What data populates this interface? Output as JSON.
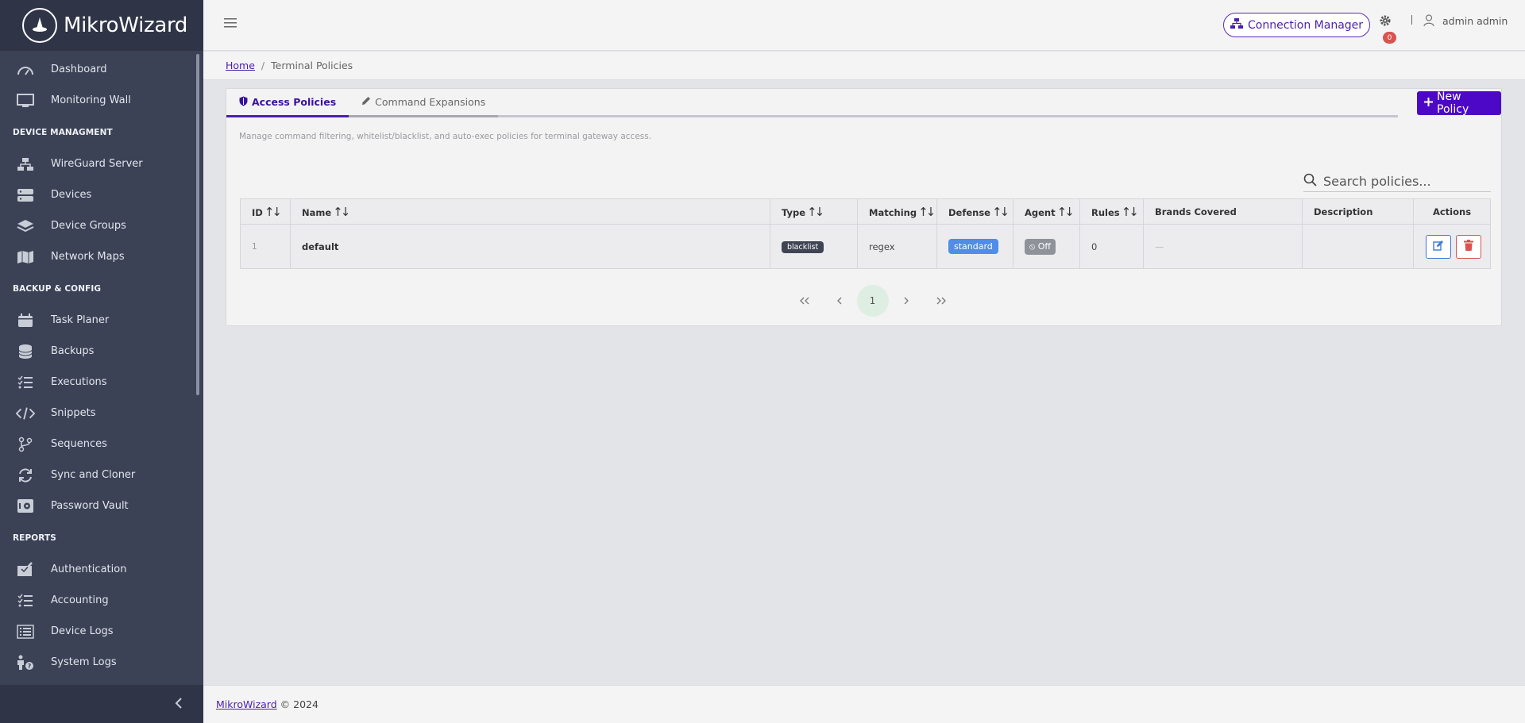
{
  "app": {
    "name": "MikroWizard",
    "logo_icon": "wizard-hat-icon"
  },
  "sidebar": {
    "items_top": [
      {
        "label": "Dashboard",
        "icon": "speedometer-icon"
      },
      {
        "label": "Monitoring Wall",
        "icon": "monitor-icon"
      }
    ],
    "sections": [
      {
        "title": "DEVICE MANAGMENT",
        "items": [
          {
            "label": "WireGuard Server",
            "icon": "network-icon"
          },
          {
            "label": "Devices",
            "icon": "server-icon"
          },
          {
            "label": "Device Groups",
            "icon": "layers-icon"
          },
          {
            "label": "Network Maps",
            "icon": "map-icon"
          }
        ]
      },
      {
        "title": "BACKUP & CONFIG",
        "items": [
          {
            "label": "Task Planer",
            "icon": "calendar-icon"
          },
          {
            "label": "Backups",
            "icon": "database-icon"
          },
          {
            "label": "Executions",
            "icon": "checklist-icon"
          },
          {
            "label": "Snippets",
            "icon": "code-icon"
          },
          {
            "label": "Sequences",
            "icon": "branch-icon"
          },
          {
            "label": "Sync and Cloner",
            "icon": "sync-icon"
          },
          {
            "label": "Password Vault",
            "icon": "safe-icon"
          }
        ]
      },
      {
        "title": "REPORTS",
        "items": [
          {
            "label": "Authentication",
            "icon": "inbox-check-icon"
          },
          {
            "label": "Accounting",
            "icon": "checklist-icon"
          },
          {
            "label": "Device Logs",
            "icon": "list-box-icon"
          },
          {
            "label": "System Logs",
            "icon": "person-question-icon"
          }
        ]
      }
    ]
  },
  "header": {
    "connection_manager": "Connection Manager",
    "notification_count": "0",
    "user_name": "admin admin"
  },
  "breadcrumb": {
    "home": "Home",
    "current": "Terminal Policies"
  },
  "tabs": [
    {
      "label": "Access Policies",
      "active": true,
      "icon": "shield-icon"
    },
    {
      "label": "Command Expansions",
      "active": false,
      "icon": "pencil-icon"
    }
  ],
  "new_policy_label": "New Policy",
  "description": "Manage command filtering, whitelist/blacklist, and auto-exec policies for terminal gateway access.",
  "search": {
    "placeholder": "Search policies..."
  },
  "table": {
    "columns": [
      "ID",
      "Name",
      "Type",
      "Matching",
      "Defense",
      "Agent",
      "Rules",
      "Brands Covered",
      "Description",
      "Actions"
    ],
    "rows": [
      {
        "id": "1",
        "name": "default",
        "type": "blacklist",
        "matching": "regex",
        "defense": "standard",
        "agent": "Off",
        "rules": "0",
        "brands": "—",
        "description": ""
      }
    ]
  },
  "pagination": {
    "current": "1",
    "first": "«",
    "prev": "‹",
    "next": "›",
    "last": "»"
  },
  "footer": {
    "link": "MikroWizard",
    "text": "© 2024"
  },
  "colors": {
    "accent": "#4d08c7",
    "sidebar": "#3b4256",
    "danger": "#d9534f",
    "info": "#4f8de8"
  }
}
